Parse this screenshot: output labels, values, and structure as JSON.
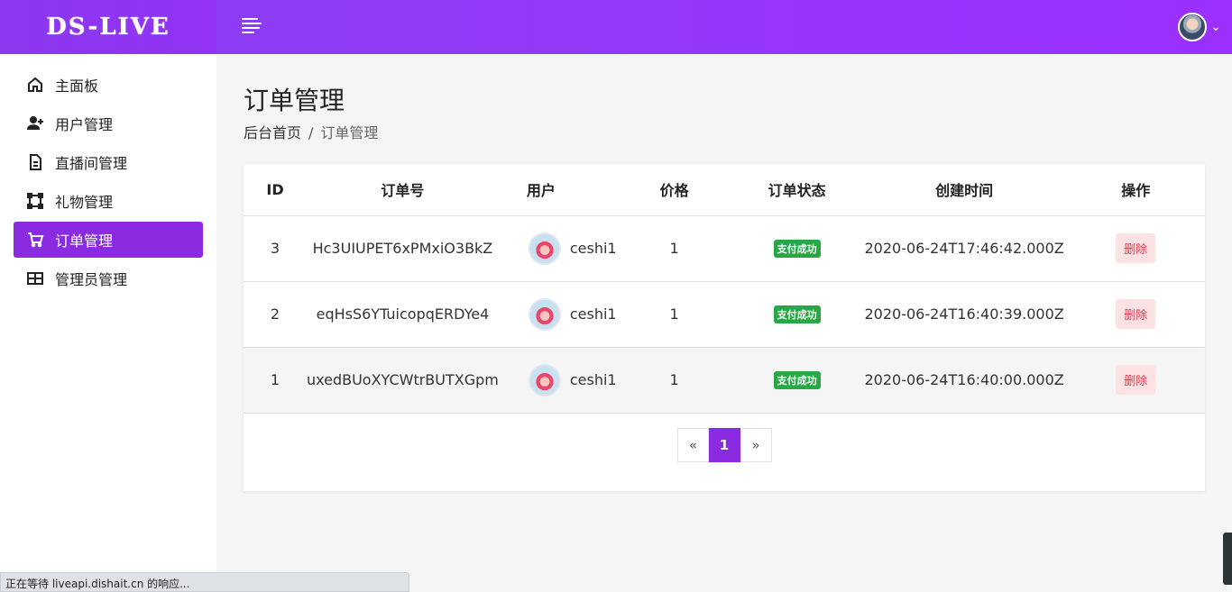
{
  "header": {
    "logo_text": "DS-LIVE",
    "brand_color": "#8a2be2"
  },
  "sidebar": {
    "items": [
      {
        "label": "主面板",
        "icon": "home-icon"
      },
      {
        "label": "用户管理",
        "icon": "user-plus-icon"
      },
      {
        "label": "直播间管理",
        "icon": "file-text-icon"
      },
      {
        "label": "礼物管理",
        "icon": "frame-icon"
      },
      {
        "label": "订单管理",
        "icon": "cart-icon",
        "active": true
      },
      {
        "label": "管理员管理",
        "icon": "table-icon"
      }
    ]
  },
  "page": {
    "title": "订单管理",
    "breadcrumb": {
      "home": "后台首页",
      "sep": "/",
      "current": "订单管理"
    }
  },
  "table": {
    "headers": [
      "ID",
      "订单号",
      "用户",
      "价格",
      "订单状态",
      "创建时间",
      "操作"
    ],
    "rows": [
      {
        "id": "3",
        "order_no": "Hc3UIUPET6xPMxiO3BkZ",
        "user": "ceshi1",
        "price": "1",
        "status": "支付成功",
        "created": "2020-06-24T17:46:42.000Z",
        "action": "删除"
      },
      {
        "id": "2",
        "order_no": "eqHsS6YTuicopqERDYe4",
        "user": "ceshi1",
        "price": "1",
        "status": "支付成功",
        "created": "2020-06-24T16:40:39.000Z",
        "action": "删除"
      },
      {
        "id": "1",
        "order_no": "uxedBUoXYCWtrBUTXGpm",
        "user": "ceshi1",
        "price": "1",
        "status": "支付成功",
        "created": "2020-06-24T16:40:00.000Z",
        "action": "删除"
      }
    ]
  },
  "pagination": {
    "prev": "«",
    "current": "1",
    "next": "»"
  },
  "statusbar": {
    "text": "正在等待 liveapi.dishait.cn 的响应..."
  }
}
